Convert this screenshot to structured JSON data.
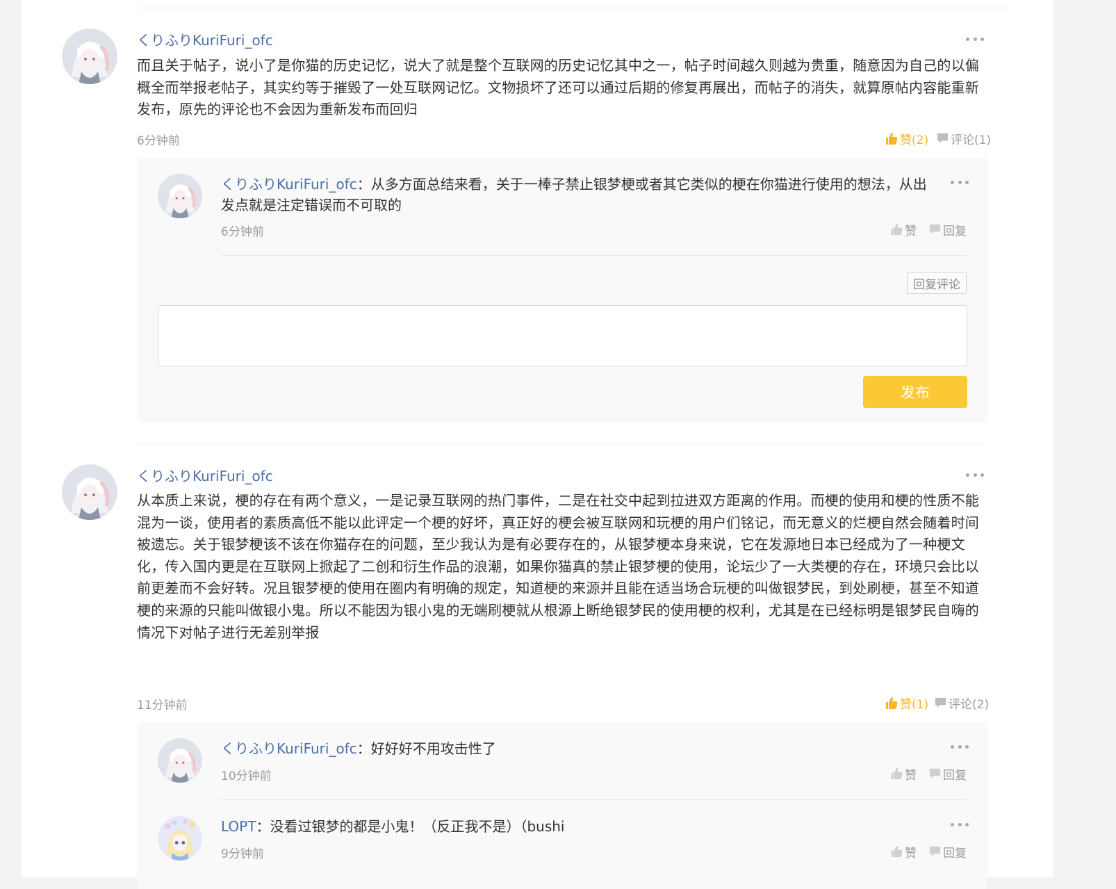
{
  "comments": [
    {
      "username": "くりふりKuriFuri_ofc",
      "text": "而且关于帖子，说小了是你猫的历史记忆，说大了就是整个互联网的历史记忆其中之一，帖子时间越久则越为贵重，随意因为自己的以偏概全而举报老帖子，其实约等于摧毁了一处互联网记忆。文物损坏了还可以通过后期的修复再展出，而帖子的消失，就算原帖内容能重新发布，原先的评论也不会因为重新发布而回归",
      "time": "6分钟前",
      "like_label": "赞(2)",
      "comment_label": "评论(1)",
      "replies": [
        {
          "username": "くりふりKuriFuri_ofc",
          "separator": "：",
          "text": "从多方面总结来看，关于一棒子禁止银梦梗或者其它类似的梗在你猫进行使用的想法，从出发点就是注定错误而不可取的",
          "time": "6分钟前",
          "like_label": "赞",
          "reply_label": "回复"
        }
      ],
      "reply_comment_label": "回复评论",
      "reply_input_placeholder": "",
      "publish_label": "发布"
    },
    {
      "username": "くりふりKuriFuri_ofc",
      "text": "从本质上来说，梗的存在有两个意义，一是记录互联网的热门事件，二是在社交中起到拉进双方距离的作用。而梗的使用和梗的性质不能混为一谈，使用者的素质高低不能以此评定一个梗的好坏，真正好的梗会被互联网和玩梗的用户们铭记，而无意义的烂梗自然会随着时间被遗忘。关于银梦梗该不该在你猫存在的问题，至少我认为是有必要存在的，从银梦梗本身来说，它在发源地日本已经成为了一种梗文化，传入国内更是在互联网上掀起了二创和衍生作品的浪潮，如果你猫真的禁止银梦梗的使用，论坛少了一大类梗的存在，环境只会比以前更差而不会好转。况且银梦梗的使用在圈内有明确的规定，知道梗的来源并且能在适当场合玩梗的叫做银梦民，到处刷梗，甚至不知道梗的来源的只能叫做银小鬼。所以不能因为银小鬼的无端刷梗就从根源上断绝银梦民的使用梗的权利，尤其是在已经标明是银梦民自嗨的情况下对帖子进行无差别举报",
      "time": "11分钟前",
      "like_label": "赞(1)",
      "comment_label": "评论(2)",
      "replies": [
        {
          "username": "くりふりKuriFuri_ofc",
          "separator": "：",
          "text": "好好好不用攻击性了",
          "time": "10分钟前",
          "like_label": "赞",
          "reply_label": "回复"
        },
        {
          "username": "LOPT",
          "separator": "：",
          "text": "没看过银梦的都是小鬼！（反正我不是）（bushi",
          "time": "9分钟前",
          "like_label": "赞",
          "reply_label": "回复"
        }
      ]
    }
  ],
  "colors": {
    "accent": "#fcc935",
    "like_active": "#f5b62a",
    "username": "#4a6ea8",
    "muted": "#9b9b9b"
  },
  "icons": {
    "like": "thumbs-up-icon",
    "comment": "speech-bubble-icon",
    "more": "more-dots-icon"
  }
}
